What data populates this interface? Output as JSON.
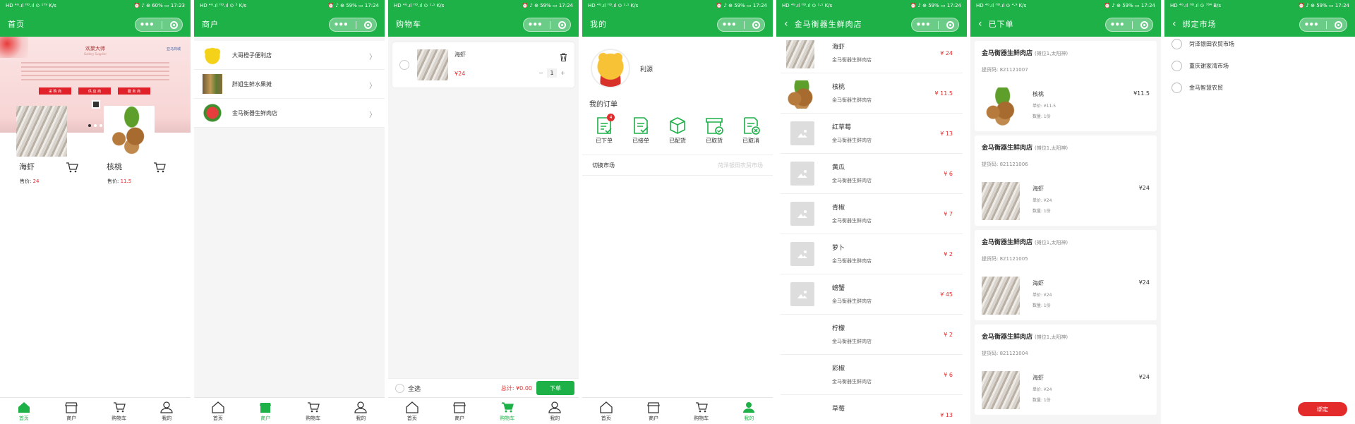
{
  "status_bars": [
    {
      "left": "HD ⁴ᴳ.ıl ᴴᴰ.ıl ⊙ ¹⁷⁹ K/s",
      "right": "⏰ ♪ ⊕ 60% ▭ 17:23"
    },
    {
      "left": "HD ⁴ᴳ.ıl ᴴᴰ.ıl ⊙ ³ K/s",
      "right": "⏰ ♪ ⊕ 59% ▭ 17:24"
    },
    {
      "left": "HD ⁴ᴳ.ıl ᴴᴰ.ıl ⊙ ¹·¹ K/s",
      "right": "⏰ ♪ ⊕ 59% ▭ 17:24"
    },
    {
      "left": "HD ⁴ᴳ.ıl ᴴᴰ.ıl ⊙ ¹·¹ K/s",
      "right": "⏰ ♪ ⊕ 59% ▭ 17:24"
    },
    {
      "left": "HD ⁴ᴳ.ıl ᴴᴰ.ıl ⊙ ¹·¹ K/s",
      "right": "⏰ ♪ ⊕ 59% ▭ 17:24"
    },
    {
      "left": "HD ⁴ᴳ.ıl ᴴᴰ.ıl ⊙ ⁴·⁹ K/s",
      "right": "⏰ ♪ ⊕ 59% ▭ 17:24"
    },
    {
      "left": "HD ⁴ᴳ.ıl ᴴᴰ.ıl ⊙ ⁷⁸⁴ B/s",
      "right": "⏰ ♪ ⊕ 59% ▭ 17:24"
    }
  ],
  "titles": [
    "首页",
    "商户",
    "购物车",
    "我的",
    "金马衡器生鲜肉店",
    "已下单",
    "绑定市场"
  ],
  "capsule": {
    "dots": "•••"
  },
  "tabbar": {
    "home": "首页",
    "merchant": "商户",
    "cart": "购物车",
    "mine": "我的"
  },
  "banner": {
    "title": "欢聚大师",
    "subtitle": "Gallery Supplier",
    "logo": "亚马商城",
    "btn1": "采 购 商",
    "btn2": "供 应 商",
    "btn3": "服 务 商",
    "footer": "广东亚马商城有限公司"
  },
  "home_products": [
    {
      "name": "海虾",
      "price_label": "售价:",
      "price": "24",
      "image": "shrimp"
    },
    {
      "name": "核桃",
      "price_label": "售价:",
      "price": "11.5",
      "image": "walnut"
    }
  ],
  "merchants": [
    {
      "name": "大哥橙子便利店",
      "image": "yellow-shirt"
    },
    {
      "name": "胖姐生鲜水果摊",
      "image": "fruit-stall"
    },
    {
      "name": "金马衡器生鲜肉店",
      "image": "watermelon"
    }
  ],
  "cart": {
    "item": {
      "name": "海虾",
      "price": "¥24",
      "qty": "1"
    },
    "select_all": "全选",
    "total": "总计: ¥0.00",
    "order_btn": "下单"
  },
  "mine": {
    "username": "利源",
    "orders_title": "我的订单",
    "order_types": [
      {
        "label": "已下单",
        "badge": "4"
      },
      {
        "label": "已接单"
      },
      {
        "label": "已配货"
      },
      {
        "label": "已取货"
      },
      {
        "label": "已取消"
      }
    ],
    "switch_market": "切换市场",
    "market_value": "菏泽银田农贸市场"
  },
  "shop_goods": [
    {
      "name": "海虾",
      "shop": "金马衡器生鲜肉店",
      "price": "¥ 24",
      "image": "shrimp"
    },
    {
      "name": "核桃",
      "shop": "金马衡器生鲜肉店",
      "price": "¥ 11.5",
      "image": "walnut"
    },
    {
      "name": "红草莓",
      "shop": "金马衡器生鲜肉店",
      "price": "¥ 13",
      "image": "placeholder"
    },
    {
      "name": "黄瓜",
      "shop": "金马衡器生鲜肉店",
      "price": "¥ 6",
      "image": "placeholder"
    },
    {
      "name": "青椒",
      "shop": "金马衡器生鲜肉店",
      "price": "¥ 7",
      "image": "placeholder"
    },
    {
      "name": "萝卜",
      "shop": "金马衡器生鲜肉店",
      "price": "¥ 2",
      "image": "placeholder"
    },
    {
      "name": "螃蟹",
      "shop": "金马衡器生鲜肉店",
      "price": "¥ 45",
      "image": "placeholder"
    },
    {
      "name": "柠檬",
      "shop": "金马衡器生鲜肉店",
      "price": "¥ 2",
      "image": "none"
    },
    {
      "name": "彩椒",
      "shop": "金马衡器生鲜肉店",
      "price": "¥ 6",
      "image": "none"
    },
    {
      "name": "草莓",
      "shop": "",
      "price": "¥ 13",
      "image": "none"
    }
  ],
  "orders": [
    {
      "shop": "金马衡器生鲜肉店",
      "stall": "(摊位1,太阳神)",
      "code": "提货码: 821121007",
      "name": "核桃",
      "price": "¥11.5",
      "unit": "单价: ¥11.5",
      "qty": "数量: 1份",
      "image": "walnut"
    },
    {
      "shop": "金马衡器生鲜肉店",
      "stall": "(摊位1,太阳神)",
      "code": "提货码: 821121006",
      "name": "海虾",
      "price": "¥24",
      "unit": "单价: ¥24",
      "qty": "数量: 1份",
      "image": "shrimp"
    },
    {
      "shop": "金马衡器生鲜肉店",
      "stall": "(摊位1,太阳神)",
      "code": "提货码: 821121005",
      "name": "海虾",
      "price": "¥24",
      "unit": "单价: ¥24",
      "qty": "数量: 1份",
      "image": "shrimp"
    },
    {
      "shop": "金马衡器生鲜肉店",
      "stall": "(摊位1,太阳神)",
      "code": "提货码: 821121004",
      "name": "海虾",
      "price": "¥24",
      "unit": "单价: ¥24",
      "qty": "数量: 1份",
      "image": "shrimp"
    }
  ],
  "markets": [
    "菏泽银田农贸市场",
    "重庆谢家湾市场",
    "金马智慧农贸"
  ],
  "bind_btn": "绑定",
  "colors": {
    "primary": "#1db148",
    "price": "#e42b2b",
    "bind": "#e42b2b"
  }
}
